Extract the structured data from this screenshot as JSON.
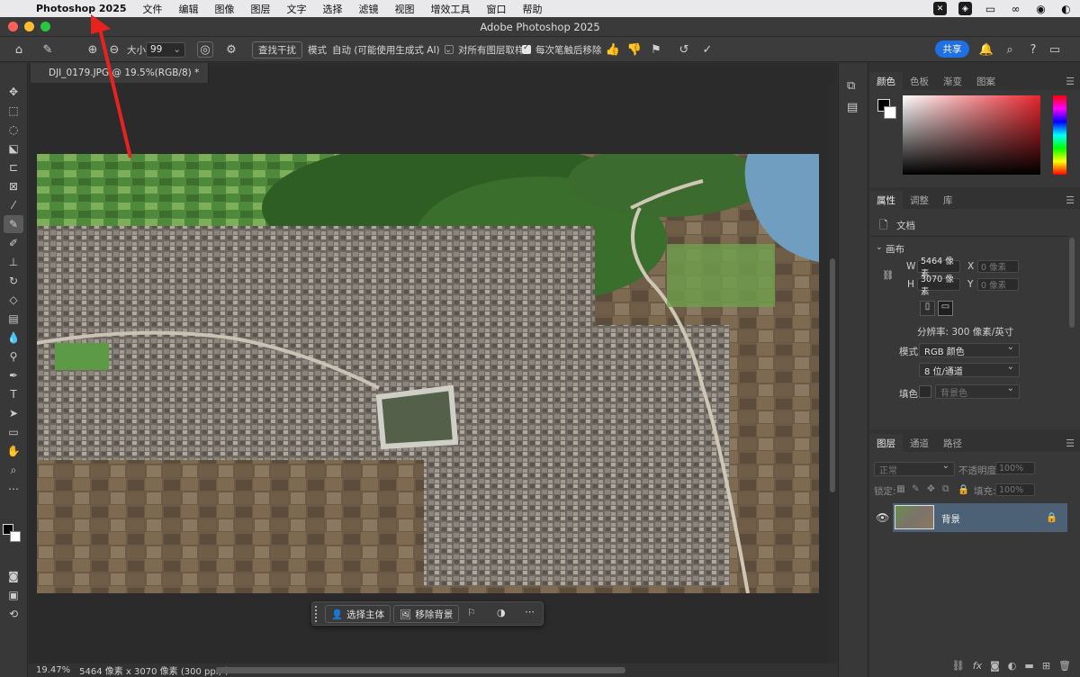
{
  "menubar": {
    "app_name": "Photoshop 2025",
    "items": [
      "文件",
      "编辑",
      "图像",
      "图层",
      "文字",
      "选择",
      "滤镜",
      "视图",
      "增效工具",
      "窗口",
      "帮助"
    ]
  },
  "window": {
    "title": "Adobe Photoshop 2025"
  },
  "options_bar": {
    "size_label": "大小",
    "size_value": "99",
    "find_edges_label": "查找干扰",
    "mode_label": "模式",
    "mode_value": "自动 (可能使用生成式 AI)",
    "sample_all_layers": "对所有图层取样",
    "sample_all_layers_checked": false,
    "remove_after_stroke": "每次笔触后移除",
    "remove_after_stroke_checked": true,
    "share_label": "共享"
  },
  "document": {
    "tab_title": "DJI_0179.JPG @ 19.5%(RGB/8) *",
    "status_zoom": "19.47%",
    "status_info": "5464 像素 x 3070 像素 (300 ppi)",
    "status_arrow": "〉"
  },
  "taskbar": {
    "select_subject": "选择主体",
    "remove_background": "移除背景"
  },
  "color_panel": {
    "tabs": [
      "颜色",
      "色板",
      "渐变",
      "图案"
    ],
    "active_tab": 0
  },
  "properties_panel": {
    "tabs": [
      "属性",
      "调整",
      "库"
    ],
    "active_tab": 0,
    "doc_label": "文档",
    "canvas_section": "画布",
    "w_label": "W",
    "w_value": "5464 像素",
    "h_label": "H",
    "h_value": "3070 像素",
    "x_label": "X",
    "x_value": "0 像素",
    "y_label": "Y",
    "y_value": "0 像素",
    "resolution": "分辨率: 300 像素/英寸",
    "mode_label": "模式",
    "mode_value": "RGB 颜色",
    "bit_depth": "8 位/通道",
    "fill_label": "填色",
    "fill_value": "背景色"
  },
  "layers_panel": {
    "tabs": [
      "图层",
      "通道",
      "路径"
    ],
    "active_tab": 0,
    "blend_mode": "正常",
    "opacity_label": "不透明度:",
    "opacity_value": "100%",
    "lock_label": "锁定:",
    "fill_label": "填充:",
    "fill_value": "100%",
    "layers": [
      {
        "name": "背景",
        "visible": true,
        "locked": true
      }
    ]
  },
  "colors": {
    "accent": "#1f6fe5",
    "annotation_arrow": "#e8231f",
    "layer_selected": "#4d6176"
  }
}
